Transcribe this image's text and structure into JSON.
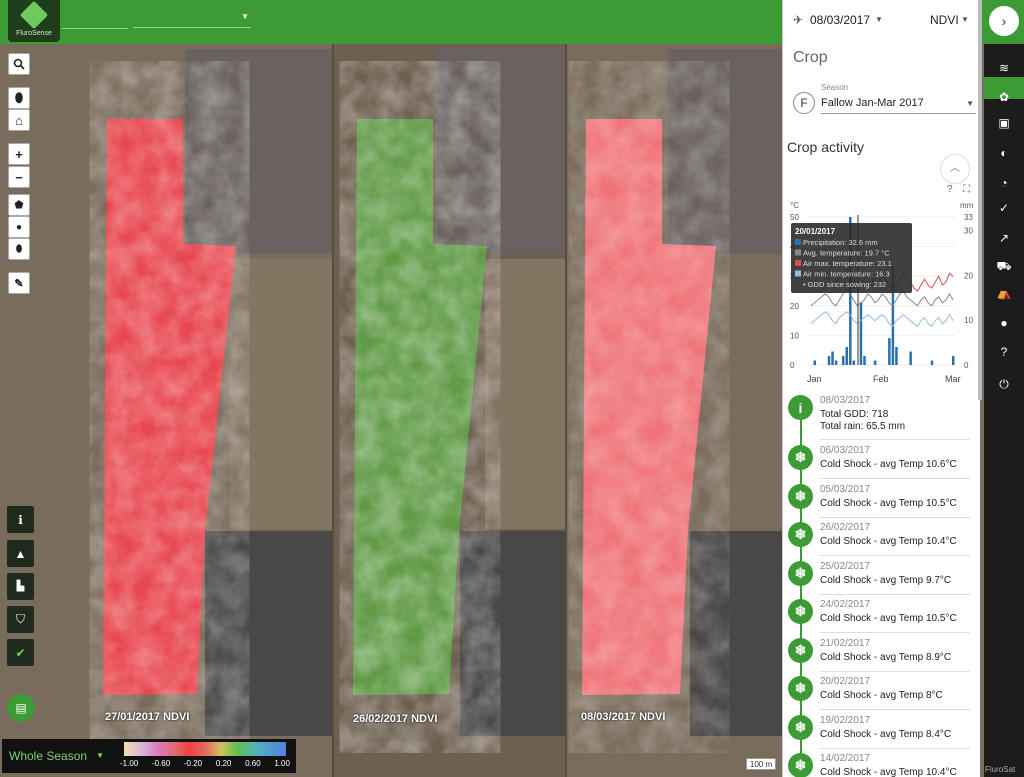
{
  "app": {
    "logo_text": "FluroSense"
  },
  "map": {
    "captions": [
      "27/01/2017 NDVI",
      "26/02/2017 NDVI",
      "08/03/2017 NDVI"
    ],
    "scale_text": "100 m",
    "credit": "FluroSat"
  },
  "legend": {
    "period": "Whole Season",
    "labels": [
      "-1.00",
      "-0.60",
      "-0.20",
      "0.20",
      "0.60",
      "1.00"
    ]
  },
  "panel": {
    "date": "08/03/2017",
    "layer": "NDVI",
    "crop_title": "Crop",
    "season_label": "Season",
    "season_initial": "F",
    "season_value": "Fallow Jan-Mar 2017",
    "activity_title": "Crop activity"
  },
  "chart_data": {
    "type": "bar",
    "title": "",
    "left_axis_unit": "°C",
    "right_axis_unit": "mm",
    "left_ticks": [
      0,
      10,
      20,
      30,
      40,
      50
    ],
    "right_ticks": [
      0,
      10,
      20,
      30,
      33
    ],
    "x_ticks": [
      "Jan",
      "Feb",
      "Mar"
    ],
    "tooltip": {
      "date": "20/01/2017",
      "lines": [
        "Precipitation: 32.6 mm",
        "Avg. temperature: 19.7 °C",
        "Air max. temperature: 23.1",
        "Air min. temperature: 16.3",
        "GDD since sowing: 232"
      ]
    },
    "series": [
      {
        "name": "Precipitation",
        "color": "#2a6fb0",
        "values": [
          0,
          1,
          0,
          0,
          0,
          2,
          3,
          1,
          0,
          2,
          4,
          33,
          1,
          0,
          14,
          2,
          0,
          0,
          1,
          0,
          0,
          0,
          6,
          22,
          4,
          0,
          0,
          0,
          3,
          0,
          0,
          0,
          0,
          0,
          1,
          0,
          0,
          0,
          0,
          0,
          2
        ]
      },
      {
        "name": "Avg. temperature",
        "color": "#888888",
        "values": [
          20,
          21,
          22,
          23,
          24,
          23,
          21,
          20,
          22,
          24,
          26,
          24,
          22,
          20,
          21,
          22,
          24,
          23,
          21,
          22,
          24,
          23,
          21,
          20,
          22,
          24,
          25,
          23,
          22,
          21,
          20,
          22,
          23,
          21,
          20,
          22,
          23,
          21,
          22,
          24,
          22
        ]
      },
      {
        "name": "Air max. temperature",
        "color": "#d65050",
        "values": [
          26,
          28,
          30,
          32,
          31,
          29,
          27,
          28,
          30,
          31,
          33,
          30,
          28,
          26,
          27,
          29,
          31,
          30,
          27,
          28,
          30,
          29,
          27,
          25,
          27,
          29,
          31,
          29,
          28,
          26,
          25,
          27,
          29,
          27,
          26,
          28,
          30,
          27,
          28,
          31,
          30
        ]
      },
      {
        "name": "Air min. temperature",
        "color": "#9ab8e0",
        "values": [
          14,
          15,
          16,
          17,
          18,
          17,
          15,
          14,
          16,
          17,
          18,
          17,
          15,
          14,
          15,
          16,
          17,
          16,
          15,
          16,
          17,
          16,
          14,
          13,
          15,
          16,
          17,
          16,
          15,
          14,
          13,
          15,
          16,
          14,
          13,
          15,
          16,
          14,
          15,
          17,
          15
        ]
      }
    ]
  },
  "events": [
    {
      "icon": "info",
      "date": "08/03/2017",
      "text": "Total GDD: 718",
      "text2": "Total rain: 65.5 mm"
    },
    {
      "icon": "snowflake",
      "date": "06/03/2017",
      "text": "Cold Shock - avg Temp 10.6°C"
    },
    {
      "icon": "snowflake",
      "date": "05/03/2017",
      "text": "Cold Shock - avg Temp 10.5°C"
    },
    {
      "icon": "snowflake",
      "date": "26/02/2017",
      "text": "Cold Shock - avg Temp 10.4°C"
    },
    {
      "icon": "snowflake",
      "date": "25/02/2017",
      "text": "Cold Shock - avg Temp 9.7°C"
    },
    {
      "icon": "snowflake",
      "date": "24/02/2017",
      "text": "Cold Shock - avg Temp 10.5°C"
    },
    {
      "icon": "snowflake",
      "date": "21/02/2017",
      "text": "Cold Shock - avg Temp 8.9°C"
    },
    {
      "icon": "snowflake",
      "date": "20/02/2017",
      "text": "Cold Shock - avg Temp 8°C"
    },
    {
      "icon": "snowflake",
      "date": "19/02/2017",
      "text": "Cold Shock - avg Temp 8.4°C"
    },
    {
      "icon": "snowflake",
      "date": "14/02/2017",
      "text": "Cold Shock - avg Temp 10.4°C"
    }
  ],
  "rail_icons": [
    "layers-icon",
    "crop-icon",
    "images-icon",
    "contrast-icon",
    "pie-icon",
    "check-icon",
    "trend-icon",
    "tractor-icon",
    "tent-icon",
    "user-icon",
    "help-icon",
    "logout-icon"
  ],
  "colors": {
    "brand": "#3d9b35",
    "rail": "#1c1c1c"
  }
}
